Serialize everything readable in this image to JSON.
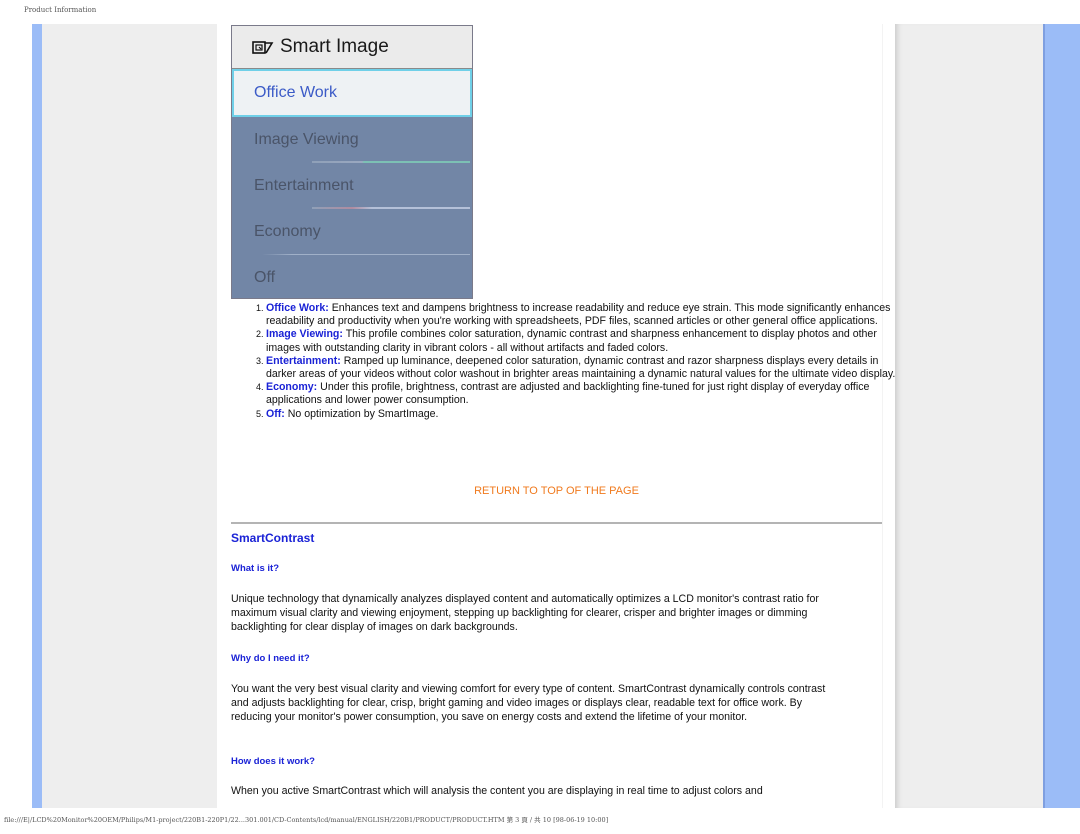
{
  "print_header": "Product Information",
  "print_footer": "file:///E|/LCD%20Monitor%20OEM/Philips/M1-project/220B1-220P1/22...301.001/CD-Contents/lcd/manual/ENGLISH/220B1/PRODUCT/PRODUCT.HTM 第 3 頁 / 共 10 [98-06-19 10:00]",
  "osd": {
    "title": "Smart Image",
    "icon": "smart-image-icon",
    "items": [
      {
        "label": "Office Work",
        "selected": true
      },
      {
        "label": "Image Viewing",
        "selected": false
      },
      {
        "label": "Entertainment",
        "selected": false
      },
      {
        "label": "Economy",
        "selected": false
      },
      {
        "label": "Off",
        "selected": false
      }
    ]
  },
  "modes": [
    {
      "name": "Office Work:",
      "desc": " Enhances text and dampens brightness to increase readability and reduce eye strain. This mode significantly enhances readability and productivity when you're working with spreadsheets, PDF files, scanned articles or other general office applications."
    },
    {
      "name": "Image Viewing:",
      "desc": " This profile combines color saturation, dynamic contrast and sharpness enhancement to display photos and other images with outstanding clarity in vibrant colors - all without artifacts and faded colors."
    },
    {
      "name": "Entertainment:",
      "desc": " Ramped up luminance, deepened color saturation, dynamic contrast and razor sharpness displays every details in darker areas of your videos without color washout in brighter areas maintaining a dynamic natural values for the ultimate video display."
    },
    {
      "name": "Economy:",
      "desc": " Under this profile, brightness, contrast are adjusted and backlighting fine-tuned for just right display of everyday office applications and lower power consumption."
    },
    {
      "name": "Off:",
      "desc": " No optimization by SmartImage."
    }
  ],
  "return_link": "RETURN TO TOP OF THE PAGE",
  "smartcontrast": {
    "title": "SmartContrast",
    "what_heading": "What is it?",
    "what_text": "Unique technology that dynamically analyzes displayed content and automatically optimizes a LCD monitor's contrast ratio for maximum visual clarity and viewing enjoyment, stepping up backlighting for clearer, crisper and brighter images or dimming backlighting for clear display of images on dark backgrounds.",
    "why_heading": "Why do I need it?",
    "why_text": "You want the very best visual clarity and viewing comfort for every type of content. SmartContrast dynamically controls contrast and adjusts backlighting for clear, crisp, bright gaming and video images or displays clear, readable text for office work. By reducing your monitor's power consumption, you save on energy costs and extend the lifetime of your monitor.",
    "how_heading": "How does it work?",
    "how_text": "When you active SmartContrast which will analysis the content you are displaying in real time to adjust colors and"
  }
}
